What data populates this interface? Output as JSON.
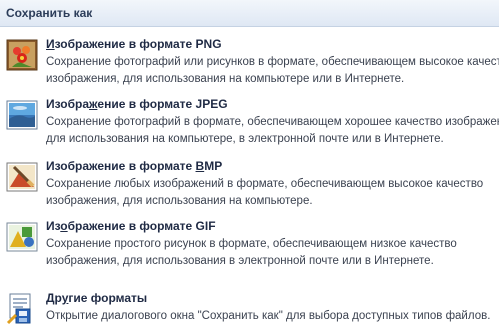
{
  "menu": {
    "header": "Сохранить как",
    "items": [
      {
        "title_pre": "",
        "title_key": "И",
        "title_post": "зображение в формате PNG",
        "desc1": "Сохранение фотографий или рисунков в формате, обеспечивающем высокое качество",
        "desc2": "изображения, для использования на компьютере или в Интернете.",
        "icon": "flower-image-icon"
      },
      {
        "title_pre": "Изобра",
        "title_key": "ж",
        "title_post": "ение в формате JPEG",
        "desc1": "Сохранение фотографий в формате, обеспечивающем хорошее качество изображения,",
        "desc2": "для использования на компьютере, в электронной почте или в Интернете.",
        "icon": "landscape-image-icon"
      },
      {
        "title_pre": "Изображение в формате ",
        "title_key": "B",
        "title_post": "MP",
        "desc1": "Сохранение любых изображений в формате, обеспечивающем высокое качество",
        "desc2": "изображения, для использования на компьютере.",
        "icon": "paint-brush-image-icon"
      },
      {
        "title_pre": "Из",
        "title_key": "о",
        "title_post": "бражение в формате GIF",
        "desc1": "Сохранение простого рисунок в формате, обеспечивающем низкое качество",
        "desc2": "изображения, для использования в электронной почте или в Интернете.",
        "icon": "shapes-image-icon"
      },
      {
        "title_pre": "Др",
        "title_key": "у",
        "title_post": "гие форматы",
        "desc1": "Открытие диалогового окна \"Сохранить как\" для выбора доступных типов файлов.",
        "desc2": "",
        "icon": "save-as-document-icon"
      }
    ]
  }
}
